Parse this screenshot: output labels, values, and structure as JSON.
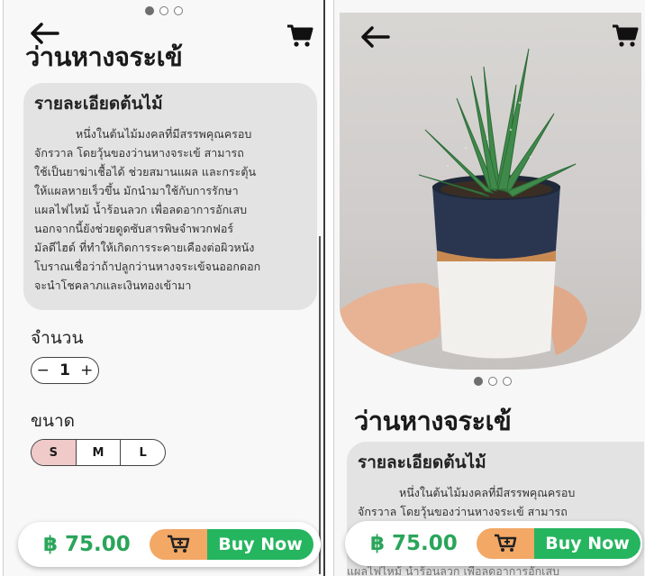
{
  "left": {
    "title": "ว่านหางจระเข้",
    "detail_heading": "รายละเอียดต้นไม้",
    "detail_body": "หนึ่งในต้นไม้มงคลที่มีสรรพคุณครอบ\nจักรวาล โดยวุ้นของว่านหางจระเข้ สามารถ\nใช้เป็นยาฆ่าเชื้อได้ ช่วยสมานแผล และกระตุ้น\nให้แผลหายเร็วขึ้น มักนำมาใช้กับการรักษา\nแผลไฟไหม้ น้ำร้อนลวก เพื่อลดอาการอักเสบ\n นอกจากนี้ยังช่วยดูดซับสารพิษจำพวกฟอร์\nมัลดีไฮด์ ที่ทำให้เกิดการระคายเคืองต่อผิวหนัง\nโบราณเชื่อว่าถ้าปลูกว่านหางจระเข้จนออกดอก\n จะนำโชคลาภและเงินทองเข้ามา",
    "quantity_label": "จำนวน",
    "quantity_minus": "−",
    "quantity_value": "1",
    "quantity_plus": "+",
    "size_label": "ขนาด",
    "sizes": [
      "S",
      "M",
      "L"
    ],
    "selected_size": "S"
  },
  "right": {
    "title": "ว่านหางจระเข้",
    "detail_heading": "รายละเอียดต้นไม้",
    "detail_body": "หนึ่งในต้นไม้มงคลที่มีสรรพคุณครอบ\nจักรวาล โดยวุ้นของว่านหางจระเข้ สามารถ",
    "overflow_text": "แผลไฟไหม้ น้ำร้อนลวก เพื่อลดอาการอักเสบ"
  },
  "buybar": {
    "price": "฿ 75.00",
    "buy_label": "Buy Now"
  },
  "carousel": {
    "page_count": 3,
    "active_index": 0
  },
  "icons": {
    "back": "back-arrow-icon",
    "cart": "cart-icon",
    "add_to_cart": "add-to-cart-icon"
  },
  "colors": {
    "price": "#2aa55a",
    "buy_button": "#25b55f",
    "cart_button": "#f3a866",
    "selected_size": "#f0c9c9",
    "card": "#e3e3e3"
  }
}
